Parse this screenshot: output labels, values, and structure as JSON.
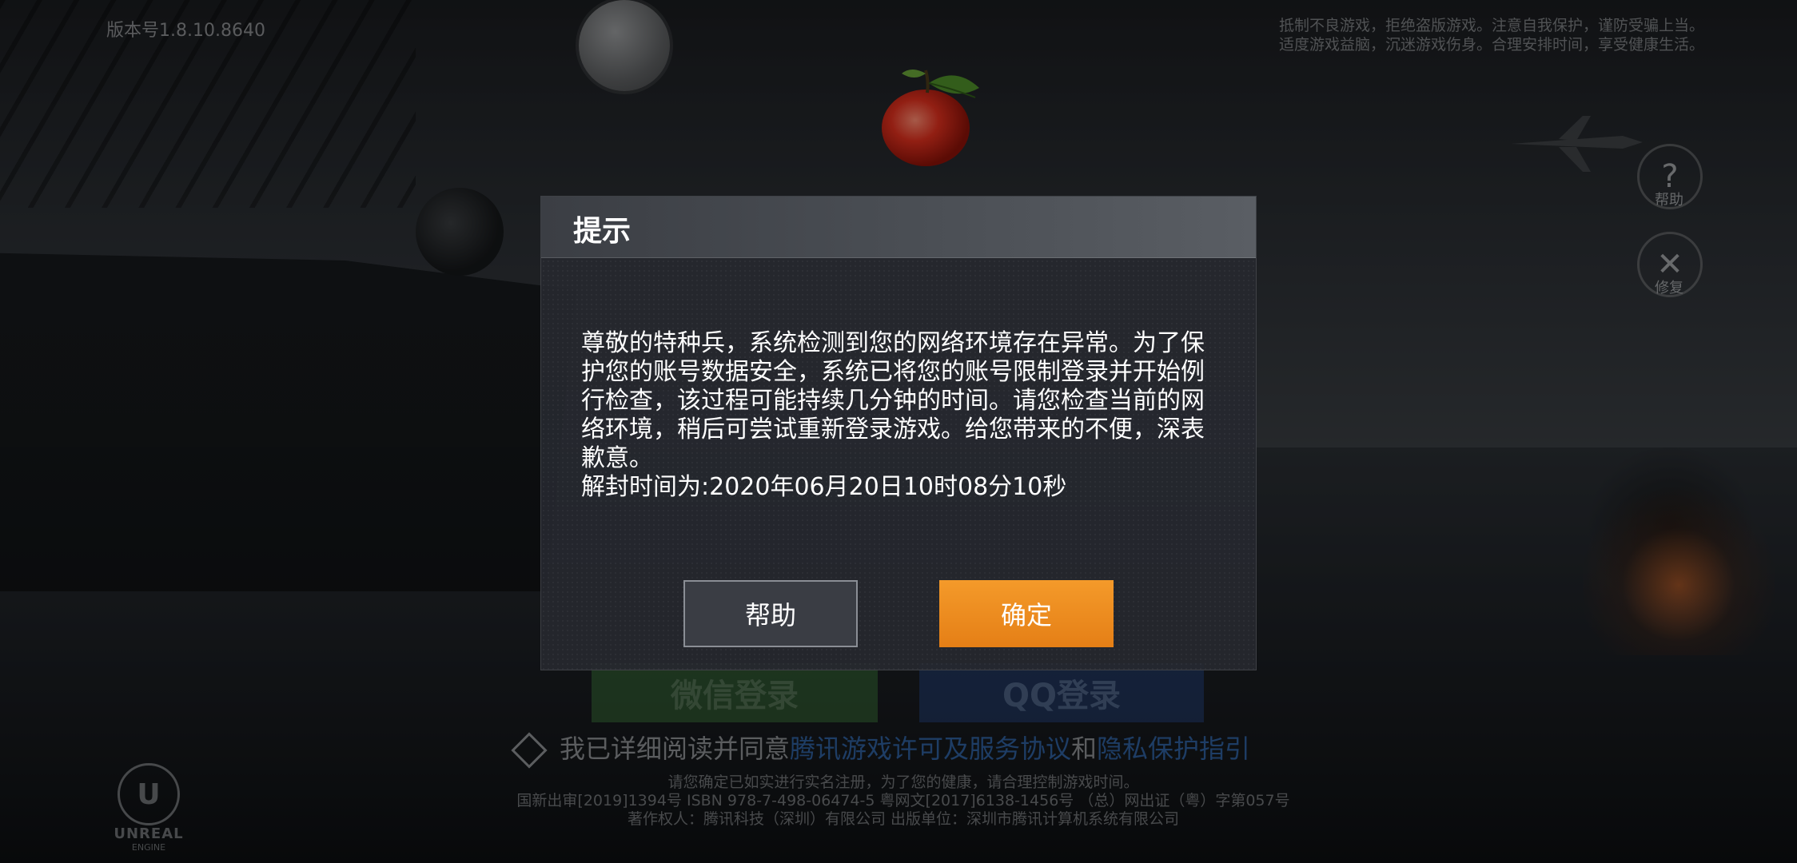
{
  "version_label": "版本号1.8.10.8640",
  "notice": {
    "line1": "抵制不良游戏，拒绝盗版游戏。注意自我保护，谨防受骗上当。",
    "line2": "适度游戏益脑，沉迷游戏伤身。合理安排时间，享受健康生活。"
  },
  "side_buttons": {
    "help_label": "帮助",
    "repair_label": "修复"
  },
  "login": {
    "wechat_label": "微信登录",
    "qq_label": "QQ登录",
    "agree_prefix": "我已详细阅读并同意",
    "agree_link1": "腾讯游戏许可及服务协议",
    "agree_and": "和",
    "agree_link2": "隐私保护指引"
  },
  "footer": {
    "line1": "请您确定已如实进行实名注册，为了您的健康，请合理控制游戏时间。",
    "line2": "国新出审[2019]1394号  ISBN 978-7-498-06474-5  粤网文[2017]6138-1456号  （总）网出证（粤）字第057号",
    "line3": "著作权人：腾讯科技（深圳）有限公司  出版单位：深圳市腾讯计算机系统有限公司"
  },
  "engine_logo": {
    "text": "UNREAL",
    "sub": "ENGINE"
  },
  "dialog": {
    "title": "提示",
    "message": "尊敬的特种兵，系统检测到您的网络环境存在异常。为了保护您的账号数据安全，系统已将您的账号限制登录并开始例行检查，该过程可能持续几分钟的时间。请您检查当前的网络环境，稍后可尝试重新登录游戏。给您带来的不便，深表歉意。",
    "unlock_label": "解封时间为:",
    "unlock_time": "2020年06月20日10时08分10秒",
    "help_button": "帮助",
    "ok_button": "确定"
  },
  "colors": {
    "ok_button": "#F08C20",
    "help_button_bg": "#3A3D44",
    "wechat": "#3D7A3B",
    "qq": "#25427A",
    "link": "#2E5F9C"
  }
}
